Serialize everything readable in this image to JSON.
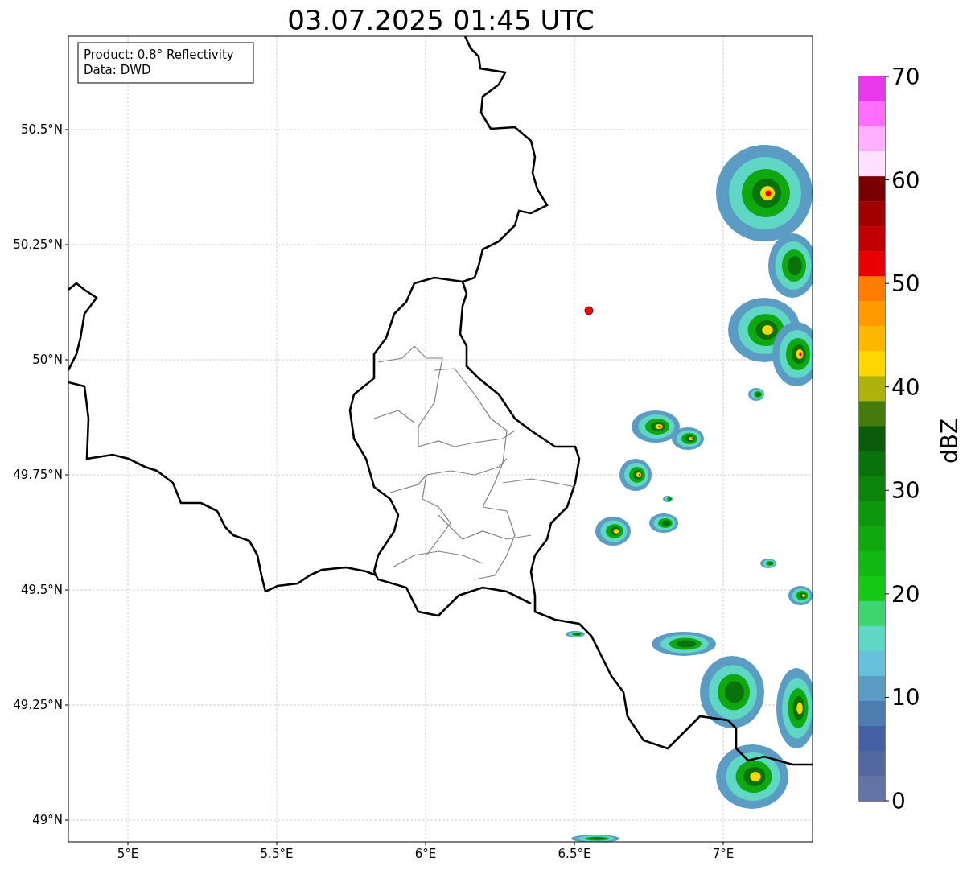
{
  "title": "03.07.2025 01:45 UTC",
  "info_box": {
    "lines": [
      "Product: 0.8° Reflectivity",
      "Data: DWD"
    ]
  },
  "longitude_ticks": [
    "5°E",
    "5.5°E",
    "6°E",
    "6.5°E",
    "7°E"
  ],
  "latitude_ticks": [
    "50.5°N",
    "50.25°N",
    "50°N",
    "49.75°N",
    "49.5°N",
    "49.25°N",
    "49°N"
  ],
  "colorbar": {
    "label": "dBZ",
    "ticks": [
      "70",
      "60",
      "50",
      "40",
      "30",
      "20",
      "10",
      "0"
    ],
    "bands": [
      {
        "color": "#e838ec"
      },
      {
        "color": "#ff6eff"
      },
      {
        "color": "#ffb0ff"
      },
      {
        "color": "#ffe0ff"
      },
      {
        "color": "#780000"
      },
      {
        "color": "#a00000"
      },
      {
        "color": "#c00000"
      },
      {
        "color": "#e80000"
      },
      {
        "color": "#ff7d00"
      },
      {
        "color": "#ff9b00"
      },
      {
        "color": "#ffb800"
      },
      {
        "color": "#ffd700"
      },
      {
        "color": "#adb30a"
      },
      {
        "color": "#457a0c"
      },
      {
        "color": "#0a5c0a"
      },
      {
        "color": "#0a720a"
      },
      {
        "color": "#0c840c"
      },
      {
        "color": "#0e960e"
      },
      {
        "color": "#10a810"
      },
      {
        "color": "#12b812"
      },
      {
        "color": "#14c814"
      },
      {
        "color": "#3dd66e"
      },
      {
        "color": "#5fd7c4"
      },
      {
        "color": "#67c0dc"
      },
      {
        "color": "#5a9cc4"
      },
      {
        "color": "#4d7db0"
      },
      {
        "color": "#4460a2"
      },
      {
        "color": "#5266a0"
      },
      {
        "color": "#6473a6"
      }
    ]
  }
}
